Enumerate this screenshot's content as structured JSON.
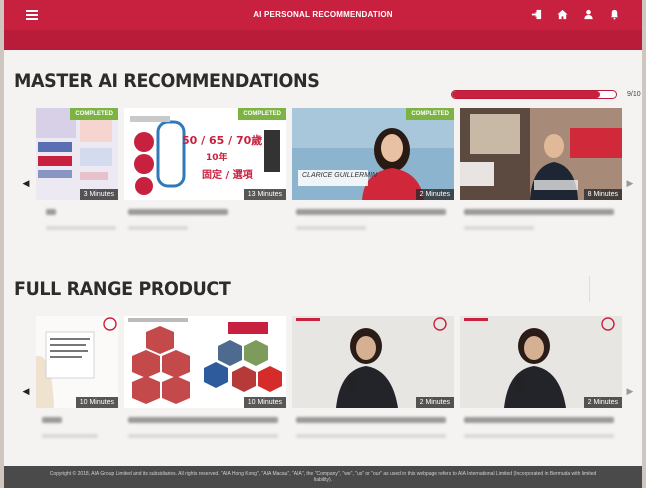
{
  "header": {
    "title": "AI PERSONAL RECOMMENDATION",
    "icons": [
      "menu-icon",
      "logout-icon",
      "home-icon",
      "user-icon",
      "notification-icon"
    ]
  },
  "recommendations": {
    "title": "MASTER AI RECOMMENDATIONS",
    "progress_label": "9/10",
    "progress_fraction": 0.9,
    "cards": [
      {
        "duration": "3 Minutes",
        "badge": "COMPLETED"
      },
      {
        "duration": "13 Minutes",
        "badge": "COMPLETED",
        "slide_text": "50 / 65 / 70歲",
        "slide_text2": "10年",
        "slide_text3": "固定 / 選項"
      },
      {
        "duration": "2 Minutes",
        "badge": "COMPLETED",
        "caption": "CLARICE GUILLERMIN"
      },
      {
        "duration": "8 Minutes",
        "badge": ""
      }
    ]
  },
  "products": {
    "title": "FULL RANGE PRODUCT",
    "cards": [
      {
        "duration": "10 Minutes"
      },
      {
        "duration": "10 Minutes"
      },
      {
        "duration": "2 Minutes"
      },
      {
        "duration": "2 Minutes"
      }
    ]
  },
  "footer": {
    "text": "Copyright © 2018, AIA Group Limited and its subsidiaries. All rights reserved. \"AIA Hong Kong\", \"AIA Macau\", \"AIA\", the \"Company\", \"we\", \"us\" or \"our\" as used in this webpage refers to AIA International Limited (Incorporated in Bermuda with limited liability)."
  },
  "colors": {
    "brand": "#c8213f",
    "completed": "#7cb342"
  }
}
